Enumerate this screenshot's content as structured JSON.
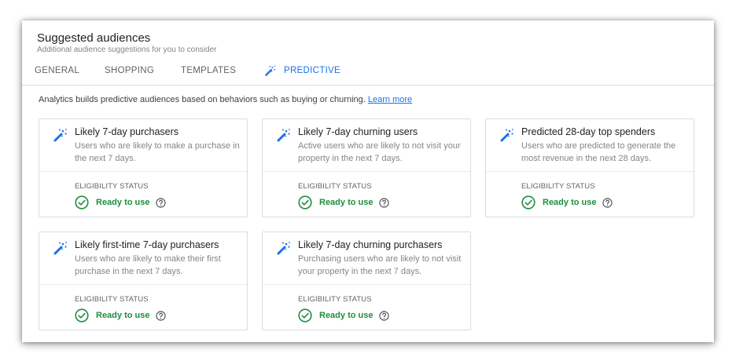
{
  "header": {
    "title": "Suggested audiences",
    "subtitle": "Additional audience suggestions for you to consider"
  },
  "tabs": [
    {
      "label": "GENERAL",
      "active": false
    },
    {
      "label": "SHOPPING",
      "active": false
    },
    {
      "label": "TEMPLATES",
      "active": false
    },
    {
      "label": "PREDICTIVE",
      "active": true,
      "icon": "magic-wand-icon"
    }
  ],
  "info": {
    "text": "Analytics builds predictive audiences based on behaviors such as buying or churning.",
    "link": "Learn more"
  },
  "colors": {
    "accent": "#1a73e8",
    "success": "#1e8e3e",
    "text_secondary": "#80868b"
  },
  "cards": [
    {
      "title": "Likely 7-day purchasers",
      "description": "Users who are likely to make a purchase in the next 7 days.",
      "eligibility_label": "ELIGIBILITY STATUS",
      "status": "Ready to use"
    },
    {
      "title": "Likely 7-day churning users",
      "description": "Active users who are likely to not visit your property in the next 7 days.",
      "eligibility_label": "ELIGIBILITY STATUS",
      "status": "Ready to use"
    },
    {
      "title": "Predicted 28-day top spenders",
      "description": "Users who are predicted to generate the most revenue in the next 28 days.",
      "eligibility_label": "ELIGIBILITY STATUS",
      "status": "Ready to use"
    },
    {
      "title": "Likely first-time 7-day purchasers",
      "description": "Users who are likely to make their first purchase in the next 7 days.",
      "eligibility_label": "ELIGIBILITY STATUS",
      "status": "Ready to use"
    },
    {
      "title": "Likely 7-day churning purchasers",
      "description": "Purchasing users who are likely to not visit your property in the next 7 days.",
      "eligibility_label": "ELIGIBILITY STATUS",
      "status": "Ready to use"
    }
  ]
}
